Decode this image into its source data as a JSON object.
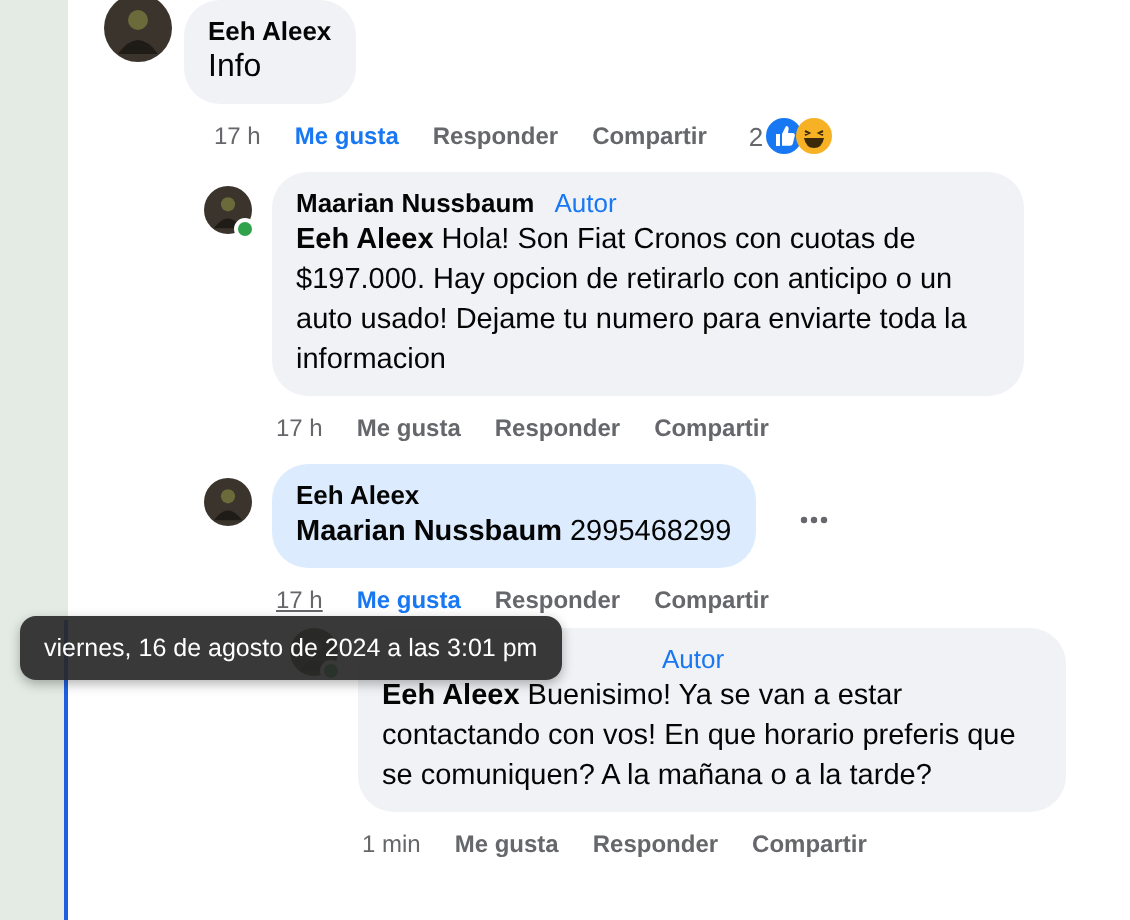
{
  "comments": [
    {
      "author": "Eeh Aleex",
      "text": "Info",
      "time": "17 h",
      "time_hovered": false,
      "liked": true,
      "online": false,
      "highlighted": false,
      "menu": false,
      "like_label": "Me gusta",
      "reply_label": "Responder",
      "share_label": "Compartir",
      "reaction_count": "2",
      "reactions": [
        {
          "kind": "like"
        },
        {
          "kind": "haha"
        }
      ],
      "children": [
        {
          "author": "Maarian Nussbaum",
          "badge": "Autor",
          "text": "**Eeh Aleex** Hola! Son Fiat Cronos con cuotas de $197.000. Hay opcion de retirarlo con anticipo o un auto usado! Dejame tu numero para enviarte toda la informacion",
          "time": "17 h",
          "time_hovered": false,
          "liked": false,
          "online": true,
          "highlighted": false,
          "menu": false,
          "like_label": "Me gusta",
          "reply_label": "Responder",
          "share_label": "Compartir"
        },
        {
          "author": "Eeh Aleex",
          "text": "**Maarian Nussbaum** 2995468299",
          "time": "17 h",
          "time_hovered": true,
          "liked": true,
          "online": false,
          "highlighted": true,
          "menu": true,
          "like_label": "Me gusta",
          "reply_label": "Responder",
          "share_label": "Compartir",
          "children": [
            {
              "badge": "Autor",
              "text": "**Eeh Aleex** Buenisimo! Ya se van a estar contactando con vos! En que horario preferis que se comuniquen? A la mañana o a la tarde?",
              "time": "1 min",
              "time_hovered": false,
              "liked": false,
              "online": true,
              "highlighted": false,
              "menu": false,
              "like_label": "Me gusta",
              "reply_label": "Responder",
              "share_label": "Compartir"
            }
          ]
        }
      ]
    }
  ],
  "tooltip": "viernes, 16 de agosto de 2024 a las 3:01 pm"
}
